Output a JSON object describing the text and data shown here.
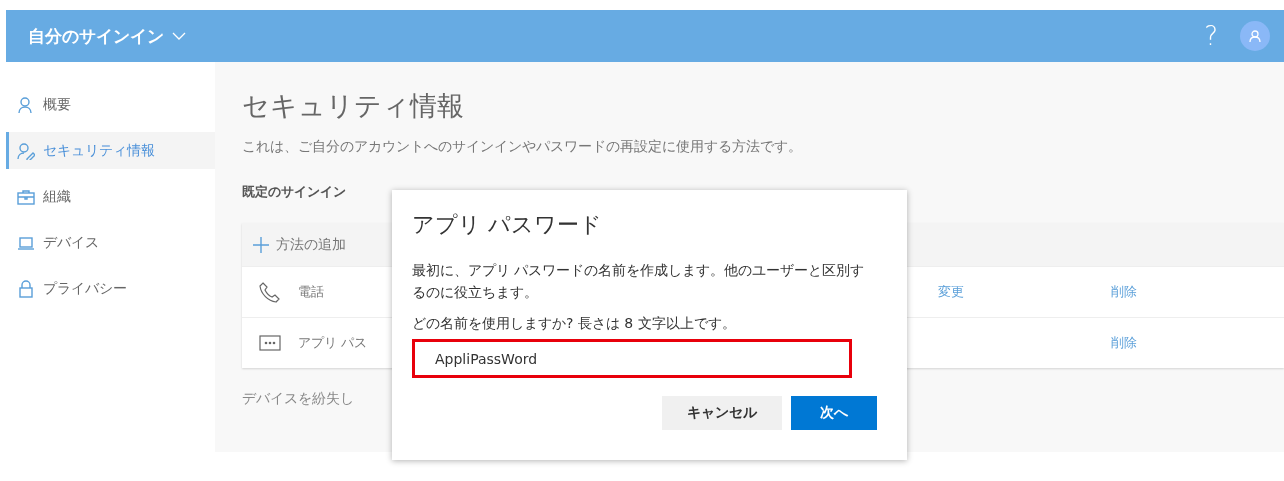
{
  "header": {
    "title": "自分のサインイン",
    "help": "?"
  },
  "sidebar": {
    "items": [
      {
        "label": "概要",
        "selected": false
      },
      {
        "label": "セキュリティ情報",
        "selected": true
      },
      {
        "label": "組織",
        "selected": false
      },
      {
        "label": "デバイス",
        "selected": false
      },
      {
        "label": "プライバシー",
        "selected": false
      }
    ]
  },
  "main": {
    "title": "セキュリティ情報",
    "description": "これは、ご自分のアカウントへのサインインやパスワードの再設定に使用する方法です。",
    "default_method_label": "既定のサインイン",
    "add_method": "方法の追加",
    "methods": [
      {
        "name": "電話",
        "change": "変更",
        "delete": "削除"
      },
      {
        "name": "アプリ パス",
        "delete": "削除"
      }
    ],
    "lost_device": "デバイスを紛失し"
  },
  "dialog": {
    "title": "アプリ パスワード",
    "intro": "最初に、アプリ パスワードの名前を作成します。他のユーザーと区別するのに役立ちます。",
    "question": "どの名前を使用しますか? 長さは 8 文字以上です。",
    "field": {
      "value": "AppliPassWord",
      "highlighted": true
    },
    "buttons": [
      {
        "label": "キャンセル",
        "kind": "secondary"
      },
      {
        "label": "次へ",
        "kind": "primary"
      }
    ]
  }
}
